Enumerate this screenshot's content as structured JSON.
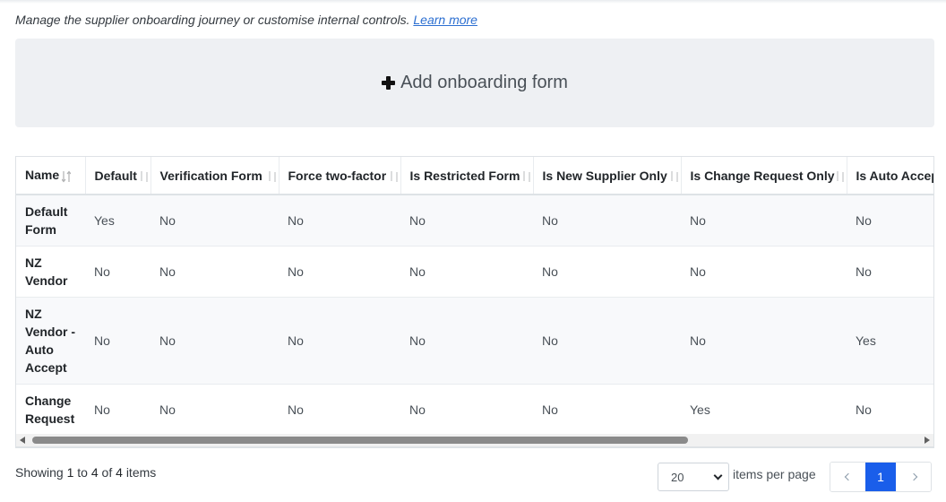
{
  "intro": {
    "text": "Manage the supplier onboarding journey or customise internal controls.",
    "link": "Learn more"
  },
  "add_panel": {
    "label": "Add onboarding form",
    "icon": "plus-icon"
  },
  "table": {
    "columns": [
      "Name",
      "Default",
      "Verification Form",
      "Force two-factor",
      "Is Restricted Form",
      "Is New Supplier Only",
      "Is Change Request Only",
      "Is Auto Accep"
    ],
    "rows": [
      [
        "Default Form",
        "Yes",
        "No",
        "No",
        "No",
        "No",
        "No",
        "No"
      ],
      [
        "NZ Vendor",
        "No",
        "No",
        "No",
        "No",
        "No",
        "No",
        "No"
      ],
      [
        "NZ Vendor - Auto Accept",
        "No",
        "No",
        "No",
        "No",
        "No",
        "No",
        "Yes"
      ],
      [
        "Change Request",
        "No",
        "No",
        "No",
        "No",
        "No",
        "Yes",
        "No"
      ]
    ]
  },
  "footer": {
    "showing_prefix": "Showing",
    "from": "1",
    "to_word": "to",
    "to": "4",
    "of_word": "of",
    "total": "4",
    "items_word": "items",
    "page_size": "20",
    "items_per_page": "items per page",
    "current_page": "1"
  },
  "colors": {
    "accent": "#1a5eea",
    "link": "#2c6fd1",
    "panel_bg": "#eef0f3"
  }
}
